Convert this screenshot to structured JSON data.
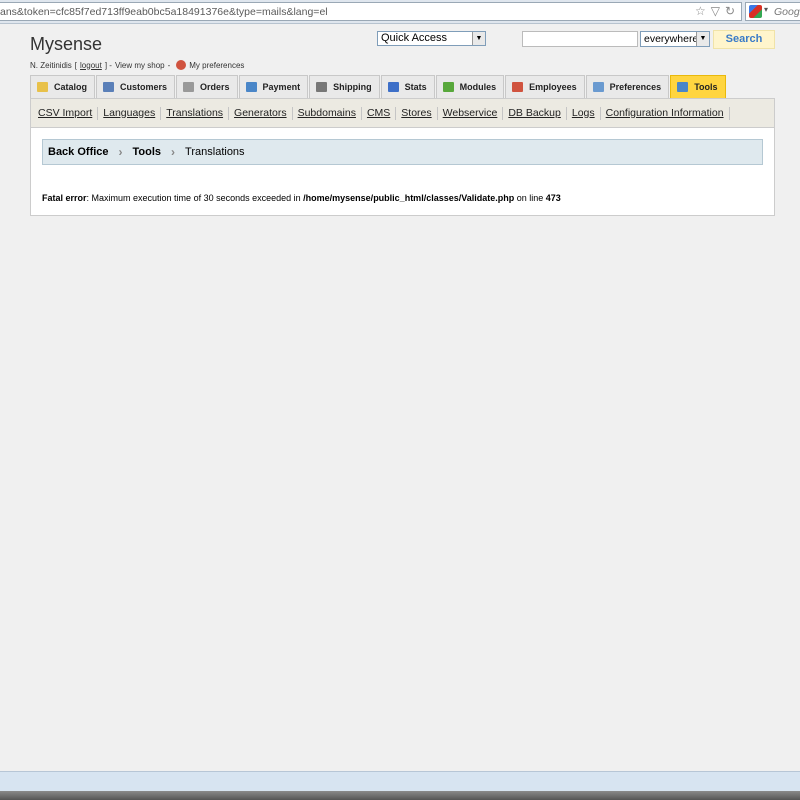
{
  "browser": {
    "url": "ans&token=cfc85f7ed713ff9eab0bc5a18491376e&type=mails&lang=el",
    "search_engine_placeholder": "Google"
  },
  "header": {
    "shop_name": "Mysense",
    "user_name": "N. Zeitinidis",
    "logout_label": "logout",
    "view_shop_label": "View my shop",
    "preferences_label": "My preferences"
  },
  "quick_access": {
    "label": "Quick Access"
  },
  "search": {
    "value": "",
    "scope": "everywhere",
    "button_label": "Search"
  },
  "tabs": [
    {
      "label": "Catalog",
      "icon": "folder-icon",
      "color": "#e8c14a"
    },
    {
      "label": "Customers",
      "icon": "user-icon",
      "color": "#5a7fb8"
    },
    {
      "label": "Orders",
      "icon": "cart-icon",
      "color": "#999999"
    },
    {
      "label": "Payment",
      "icon": "payment-icon",
      "color": "#4a86c8"
    },
    {
      "label": "Shipping",
      "icon": "truck-icon",
      "color": "#777777"
    },
    {
      "label": "Stats",
      "icon": "chart-icon",
      "color": "#3d6fc8"
    },
    {
      "label": "Modules",
      "icon": "puzzle-icon",
      "color": "#58a83c"
    },
    {
      "label": "Employees",
      "icon": "employee-icon",
      "color": "#d0533f"
    },
    {
      "label": "Preferences",
      "icon": "preferences-icon",
      "color": "#6a9ad0"
    },
    {
      "label": "Tools",
      "icon": "wrench-icon",
      "color": "#4a86c8"
    }
  ],
  "active_tab": "Tools",
  "subnav": [
    "CSV Import",
    "Languages",
    "Translations",
    "Generators",
    "Subdomains",
    "CMS",
    "Stores",
    "Webservice",
    "DB Backup",
    "Logs",
    "Configuration Information"
  ],
  "breadcrumb": [
    "Back Office",
    "Tools",
    "Translations"
  ],
  "error": {
    "label": "Fatal error",
    "message": ": Maximum execution time of 30 seconds exceeded in ",
    "path": "/home/mysense/public_html/classes/Validate.php",
    "suffix": " on line ",
    "line": "473"
  }
}
